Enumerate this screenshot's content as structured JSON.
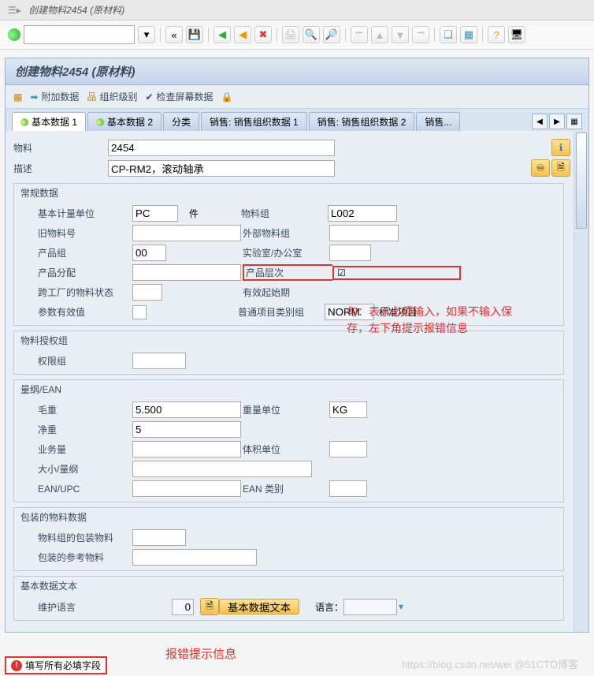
{
  "window": {
    "title": "创建物料2454 (原材料)"
  },
  "panel": {
    "title": "创建物料2454 (原材料)"
  },
  "local_toolbar": {
    "append": "附加数据",
    "org": "组织级别",
    "check": "检查屏幕数据"
  },
  "tabs": [
    "基本数据 1",
    "基本数据 2",
    "分类",
    "销售: 销售组织数据 1",
    "销售: 销售组织数据 2",
    "销售..."
  ],
  "header_fields": {
    "material_lab": "物料",
    "material": "2454",
    "desc_lab": "描述",
    "desc": "CP-RM2，滚动轴承"
  },
  "general": {
    "title": "常规数据",
    "base_uom_lab": "基本计量单位",
    "base_uom": "PC",
    "base_uom_txt": "件",
    "old_mat_lab": "旧物料号",
    "old_mat": "",
    "prod_group_lab": "产品组",
    "prod_group": "00",
    "prod_alloc_lab": "产品分配",
    "prod_alloc": "",
    "cross_plant_lab": "跨工厂的物料状态",
    "cross_plant": "",
    "param_valid_lab": "参数有效值",
    "mat_grp_lab": "物料组",
    "mat_grp": "L002",
    "ext_mat_grp_lab": "外部物料组",
    "ext_mat_grp": "",
    "lab_lab": "实验室/办公室",
    "lab": "",
    "prod_hier_lab": "产品层次",
    "prod_hier_chk": "☑",
    "valid_from_lab": "有效起始期",
    "valid_from": "",
    "gen_item_lab": "普通项目类别组",
    "gen_item": "NORM",
    "gen_item_txt": "标准项目"
  },
  "auth": {
    "title": "物料授权组",
    "perm_lab": "权限组",
    "perm": ""
  },
  "dim": {
    "title": "量纲/EAN",
    "gross_lab": "毛重",
    "gross": "5.500",
    "net_lab": "净重",
    "net": "5",
    "biz_lab": "业务量",
    "biz": "",
    "size_lab": "大小/量纲",
    "size": "",
    "ean_lab": "EAN/UPC",
    "ean": "",
    "wunit_lab": "重量单位",
    "wunit": "KG",
    "vunit_lab": "体积单位",
    "vunit": "",
    "eancat_lab": "EAN 类别",
    "eancat": ""
  },
  "pack": {
    "title": "包装的物料数据",
    "pkg_mat_lab": "物料组的包装物料",
    "ref_mat_lab": "包装的参考物料"
  },
  "text": {
    "title": "基本数据文本",
    "lang_lab": "维护语言",
    "lang": "",
    "count": "0",
    "btn": "基本数据文本",
    "lang2_lab": "语言："
  },
  "annotations": {
    "req_note": "勾：表示必须输入，如果不输入保存，左下角提示报错信息",
    "err_title": "报错提示信息"
  },
  "status": {
    "msg": "填写所有必填字段"
  },
  "watermark": "https://blog.csdn.net/wei  @51CTO博客"
}
